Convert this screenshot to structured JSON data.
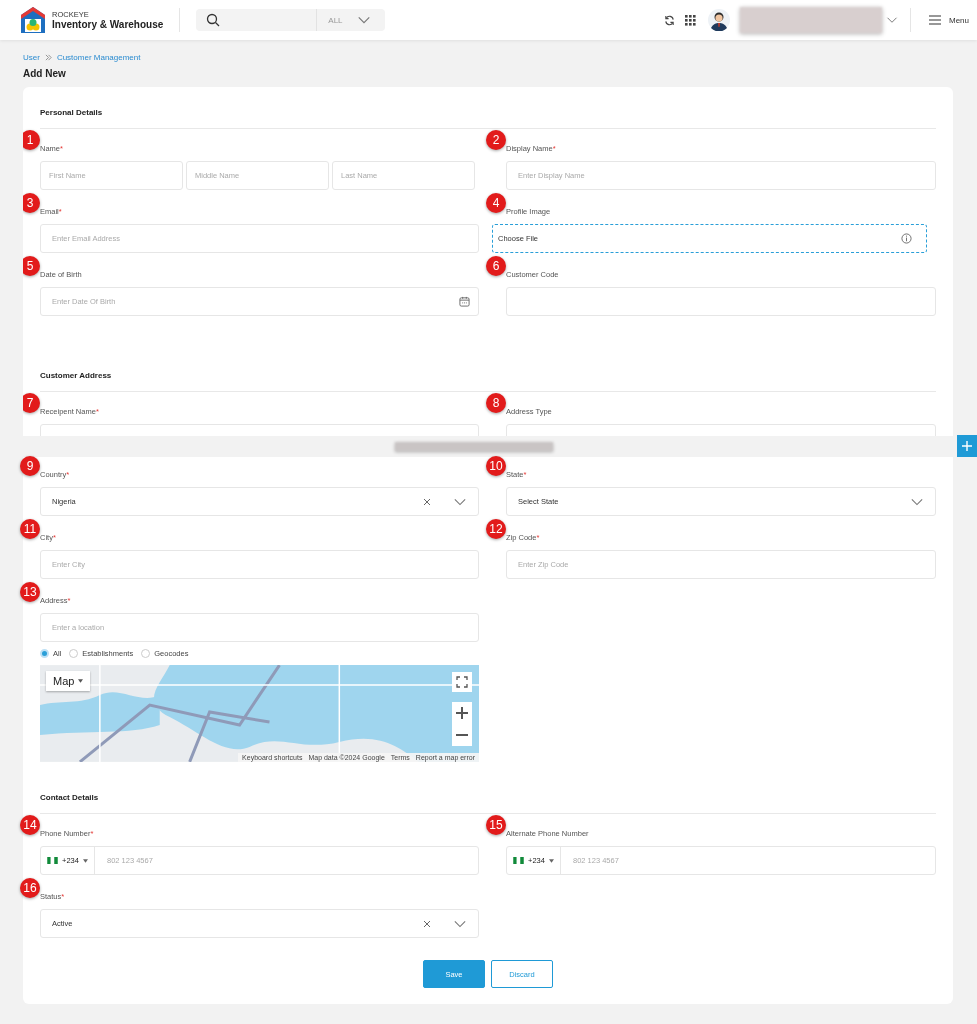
{
  "header": {
    "brand_small": "ROCKEYE",
    "brand": "Inventory & Warehouse",
    "search": {
      "filter": "ALL"
    },
    "menu_label": "Menu"
  },
  "breadcrumb": [
    {
      "label": "User"
    },
    {
      "label": "Customer Management"
    }
  ],
  "page_title": "Add New",
  "form_parts": [
    {
      "sections": [
        {
          "title": "Personal Details",
          "rows": [
            [
              {
                "marker": "1",
                "label": "Name",
                "required_mark": "*",
                "kind": "name_parts",
                "parts": [
                  {
                    "placeholder": "First Name"
                  },
                  {
                    "placeholder": "Middle Name"
                  },
                  {
                    "placeholder": "Last Name"
                  }
                ]
              },
              {
                "marker": "2",
                "label": "Display Name",
                "required_mark": "*",
                "kind": "text",
                "placeholder": "Enter Display Name"
              }
            ],
            [
              {
                "marker": "3",
                "label": "Email",
                "required_mark": "*",
                "kind": "text",
                "placeholder": "Enter Email Address"
              },
              {
                "marker": "4",
                "label": "Profile Image",
                "kind": "file",
                "value": "Choose File"
              }
            ],
            [
              {
                "marker": "5",
                "label": "Date of Birth",
                "kind": "date",
                "placeholder": "Enter Date Of Birth"
              },
              {
                "marker": "6",
                "label": "Customer Code",
                "kind": "text"
              }
            ]
          ]
        },
        {
          "title": "Customer Address",
          "rows": [
            [
              {
                "marker": "7",
                "label": "Receipent Name",
                "required_mark": "*",
                "kind": "text"
              },
              {
                "marker": "8",
                "label": "Address Type",
                "kind": "text"
              }
            ]
          ]
        }
      ]
    },
    {
      "sections": [
        {
          "rows": [
            [
              {
                "marker": "9",
                "label": "Country",
                "required_mark": "*",
                "kind": "select",
                "value": "Nigeria",
                "clearable": true
              },
              {
                "marker": "10",
                "label": "State",
                "required_mark": "*",
                "kind": "select",
                "value": "Select State",
                "clearable": false
              }
            ],
            [
              {
                "marker": "11",
                "label": "City",
                "required_mark": "*",
                "kind": "text",
                "placeholder": "Enter City"
              },
              {
                "marker": "12",
                "label": "Zip Code",
                "required_mark": "*",
                "kind": "text",
                "placeholder": "Enter Zip Code"
              }
            ],
            [
              {
                "marker": "13",
                "label": "Address",
                "required_mark": "*",
                "kind": "address",
                "placeholder": "Enter a location",
                "options": [
                  {
                    "label": "All",
                    "selected": true
                  },
                  {
                    "label": "Establishments",
                    "selected": false
                  },
                  {
                    "label": "Geocodes",
                    "selected": false
                  }
                ],
                "map": {
                  "type_button": "Map",
                  "attribution": [
                    "Keyboard shortcuts",
                    "Map data ©2024 Google",
                    "Terms",
                    "Report a map error"
                  ]
                }
              }
            ]
          ]
        },
        {
          "title": "Contact Details",
          "rows": [
            [
              {
                "marker": "14",
                "label": "Phone Number",
                "required_mark": "*",
                "kind": "phone",
                "code": "+234",
                "placeholder": "802 123 4567"
              },
              {
                "marker": "15",
                "label": "Alternate Phone Number",
                "kind": "phone",
                "code": "+234",
                "placeholder": "802 123 4567"
              }
            ],
            [
              {
                "marker": "16",
                "label": "Status",
                "required_mark": "*",
                "kind": "select",
                "value": "Active",
                "clearable": true
              }
            ]
          ]
        }
      ],
      "actions": [
        {
          "label": "Save",
          "kind": "primary"
        },
        {
          "label": "Discard",
          "kind": "outline"
        }
      ]
    }
  ]
}
